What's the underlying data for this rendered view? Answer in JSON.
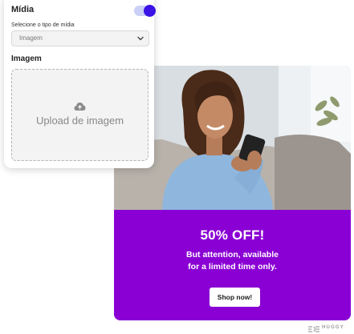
{
  "panel": {
    "midia_label": "Mídia",
    "midia_toggle_on": true,
    "select_caption": "Selecione o tipo de mídia",
    "select_value": "Imagem",
    "imagem_label": "Imagem",
    "upload_text": "Upload de imagem",
    "icons": {
      "upload": "cloud-upload-icon",
      "chevron": "chevron-down-icon"
    },
    "colors": {
      "toggle_knob": "#3a12e6",
      "toggle_track": "#c9cff5"
    }
  },
  "promo": {
    "title": "50% OFF!",
    "line1": "But attention, available",
    "line2": "for a limited time only.",
    "button": "Shop now!",
    "colors": {
      "background": "#8a00d4",
      "text": "#ffffff"
    }
  },
  "brand": {
    "name": "HUGGY"
  }
}
